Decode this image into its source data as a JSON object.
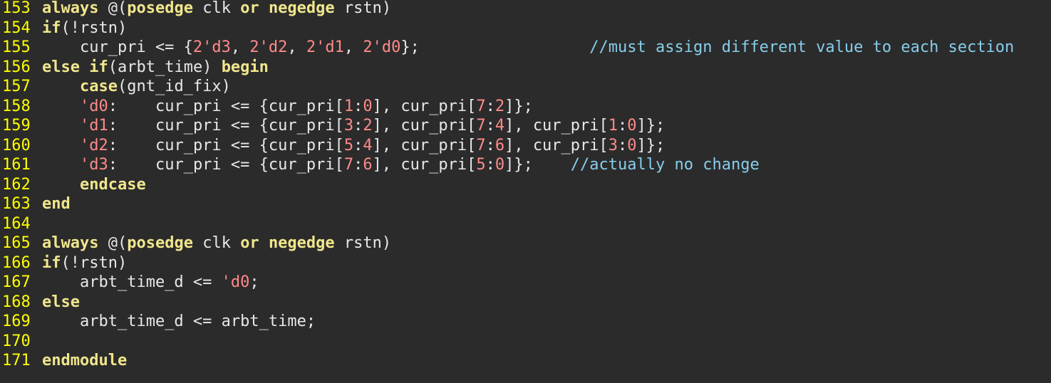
{
  "colors": {
    "background": "#2b2b2b",
    "line_number": "#ffff00",
    "keyword": "#f0e68c",
    "number": "#ff8a8a",
    "comment": "#87ceeb",
    "text": "#e8e8e8"
  },
  "lines": [
    {
      "number": "153",
      "tokens": [
        {
          "t": "always",
          "c": "kw"
        },
        {
          "t": " @(",
          "c": "txt"
        },
        {
          "t": "posedge",
          "c": "kw"
        },
        {
          "t": " clk ",
          "c": "txt"
        },
        {
          "t": "or",
          "c": "kw"
        },
        {
          "t": " ",
          "c": "txt"
        },
        {
          "t": "negedge",
          "c": "kw"
        },
        {
          "t": " rstn)",
          "c": "txt"
        }
      ]
    },
    {
      "number": "154",
      "tokens": [
        {
          "t": "if",
          "c": "kw"
        },
        {
          "t": "(!rstn)",
          "c": "txt"
        }
      ]
    },
    {
      "number": "155",
      "tokens": [
        {
          "t": "    cur_pri <= {",
          "c": "txt"
        },
        {
          "t": "2'd3",
          "c": "num"
        },
        {
          "t": ", ",
          "c": "txt"
        },
        {
          "t": "2'd2",
          "c": "num"
        },
        {
          "t": ", ",
          "c": "txt"
        },
        {
          "t": "2'd1",
          "c": "num"
        },
        {
          "t": ", ",
          "c": "txt"
        },
        {
          "t": "2'd0",
          "c": "num"
        },
        {
          "t": "};                  ",
          "c": "txt"
        },
        {
          "t": "//must assign different value to each section",
          "c": "cmt"
        }
      ]
    },
    {
      "number": "156",
      "tokens": [
        {
          "t": "else",
          "c": "kw"
        },
        {
          "t": " ",
          "c": "txt"
        },
        {
          "t": "if",
          "c": "kw"
        },
        {
          "t": "(arbt_time) ",
          "c": "txt"
        },
        {
          "t": "begin",
          "c": "kw"
        }
      ]
    },
    {
      "number": "157",
      "tokens": [
        {
          "t": "    ",
          "c": "txt"
        },
        {
          "t": "case",
          "c": "kw"
        },
        {
          "t": "(gnt_id_fix)",
          "c": "txt"
        }
      ]
    },
    {
      "number": "158",
      "tokens": [
        {
          "t": "    ",
          "c": "txt"
        },
        {
          "t": "'d0",
          "c": "num"
        },
        {
          "t": ":    cur_pri <= {cur_pri[",
          "c": "txt"
        },
        {
          "t": "1",
          "c": "num"
        },
        {
          "t": ":",
          "c": "txt"
        },
        {
          "t": "0",
          "c": "num"
        },
        {
          "t": "], cur_pri[",
          "c": "txt"
        },
        {
          "t": "7",
          "c": "num"
        },
        {
          "t": ":",
          "c": "txt"
        },
        {
          "t": "2",
          "c": "num"
        },
        {
          "t": "]};",
          "c": "txt"
        }
      ]
    },
    {
      "number": "159",
      "tokens": [
        {
          "t": "    ",
          "c": "txt"
        },
        {
          "t": "'d1",
          "c": "num"
        },
        {
          "t": ":    cur_pri <= {cur_pri[",
          "c": "txt"
        },
        {
          "t": "3",
          "c": "num"
        },
        {
          "t": ":",
          "c": "txt"
        },
        {
          "t": "2",
          "c": "num"
        },
        {
          "t": "], cur_pri[",
          "c": "txt"
        },
        {
          "t": "7",
          "c": "num"
        },
        {
          "t": ":",
          "c": "txt"
        },
        {
          "t": "4",
          "c": "num"
        },
        {
          "t": "], cur_pri[",
          "c": "txt"
        },
        {
          "t": "1",
          "c": "num"
        },
        {
          "t": ":",
          "c": "txt"
        },
        {
          "t": "0",
          "c": "num"
        },
        {
          "t": "]};",
          "c": "txt"
        }
      ]
    },
    {
      "number": "160",
      "tokens": [
        {
          "t": "    ",
          "c": "txt"
        },
        {
          "t": "'d2",
          "c": "num"
        },
        {
          "t": ":    cur_pri <= {cur_pri[",
          "c": "txt"
        },
        {
          "t": "5",
          "c": "num"
        },
        {
          "t": ":",
          "c": "txt"
        },
        {
          "t": "4",
          "c": "num"
        },
        {
          "t": "], cur_pri[",
          "c": "txt"
        },
        {
          "t": "7",
          "c": "num"
        },
        {
          "t": ":",
          "c": "txt"
        },
        {
          "t": "6",
          "c": "num"
        },
        {
          "t": "], cur_pri[",
          "c": "txt"
        },
        {
          "t": "3",
          "c": "num"
        },
        {
          "t": ":",
          "c": "txt"
        },
        {
          "t": "0",
          "c": "num"
        },
        {
          "t": "]};",
          "c": "txt"
        }
      ]
    },
    {
      "number": "161",
      "tokens": [
        {
          "t": "    ",
          "c": "txt"
        },
        {
          "t": "'d3",
          "c": "num"
        },
        {
          "t": ":    cur_pri <= {cur_pri[",
          "c": "txt"
        },
        {
          "t": "7",
          "c": "num"
        },
        {
          "t": ":",
          "c": "txt"
        },
        {
          "t": "6",
          "c": "num"
        },
        {
          "t": "], cur_pri[",
          "c": "txt"
        },
        {
          "t": "5",
          "c": "num"
        },
        {
          "t": ":",
          "c": "txt"
        },
        {
          "t": "0",
          "c": "num"
        },
        {
          "t": "]};    ",
          "c": "txt"
        },
        {
          "t": "//actually no change",
          "c": "cmt"
        }
      ]
    },
    {
      "number": "162",
      "tokens": [
        {
          "t": "    ",
          "c": "txt"
        },
        {
          "t": "endcase",
          "c": "kw"
        }
      ]
    },
    {
      "number": "163",
      "tokens": [
        {
          "t": "end",
          "c": "kw"
        }
      ]
    },
    {
      "number": "164",
      "tokens": []
    },
    {
      "number": "165",
      "tokens": [
        {
          "t": "always",
          "c": "kw"
        },
        {
          "t": " @(",
          "c": "txt"
        },
        {
          "t": "posedge",
          "c": "kw"
        },
        {
          "t": " clk ",
          "c": "txt"
        },
        {
          "t": "or",
          "c": "kw"
        },
        {
          "t": " ",
          "c": "txt"
        },
        {
          "t": "negedge",
          "c": "kw"
        },
        {
          "t": " rstn)",
          "c": "txt"
        }
      ]
    },
    {
      "number": "166",
      "tokens": [
        {
          "t": "if",
          "c": "kw"
        },
        {
          "t": "(!rstn)",
          "c": "txt"
        }
      ]
    },
    {
      "number": "167",
      "tokens": [
        {
          "t": "    arbt_time_d <= ",
          "c": "txt"
        },
        {
          "t": "'d0",
          "c": "num"
        },
        {
          "t": ";",
          "c": "txt"
        }
      ]
    },
    {
      "number": "168",
      "tokens": [
        {
          "t": "else",
          "c": "kw"
        }
      ]
    },
    {
      "number": "169",
      "tokens": [
        {
          "t": "    arbt_time_d <= arbt_time;",
          "c": "txt"
        }
      ]
    },
    {
      "number": "170",
      "tokens": []
    },
    {
      "number": "171",
      "tokens": [
        {
          "t": "endmodule",
          "c": "kw"
        }
      ]
    }
  ]
}
